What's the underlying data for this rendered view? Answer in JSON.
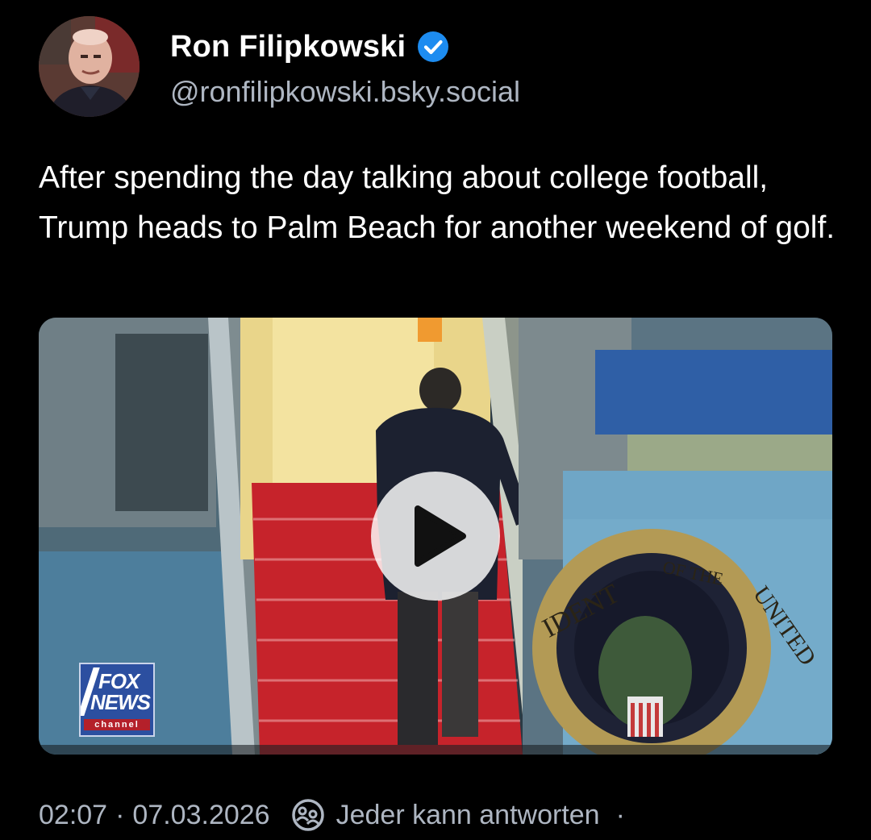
{
  "author": {
    "display_name": "Ron Filipkowski",
    "handle": "@ronfilipkowski.bsky.social",
    "avatar_icon": "profile-photo",
    "verified_icon": "verified-check-icon"
  },
  "post": {
    "text": "After spending the day talking about college football, Trump heads to Palm Beach for another weekend of golf."
  },
  "video": {
    "play_icon": "play-icon",
    "watermark": {
      "line1": "FOX",
      "line2": "NEWS",
      "line3": "channel"
    },
    "seal_text": "IDENT OF THE UNITED"
  },
  "footer": {
    "time": "02:07",
    "separator": "·",
    "date": "07.03.2026",
    "reply_setting_icon": "reply-setting-icon",
    "reply_setting": "Jeder kann antworten",
    "trailing_separator": "·"
  },
  "colors": {
    "background": "#000000",
    "text": "#ffffff",
    "muted": "#aeb6c2",
    "verified": "#1d8cf0"
  }
}
